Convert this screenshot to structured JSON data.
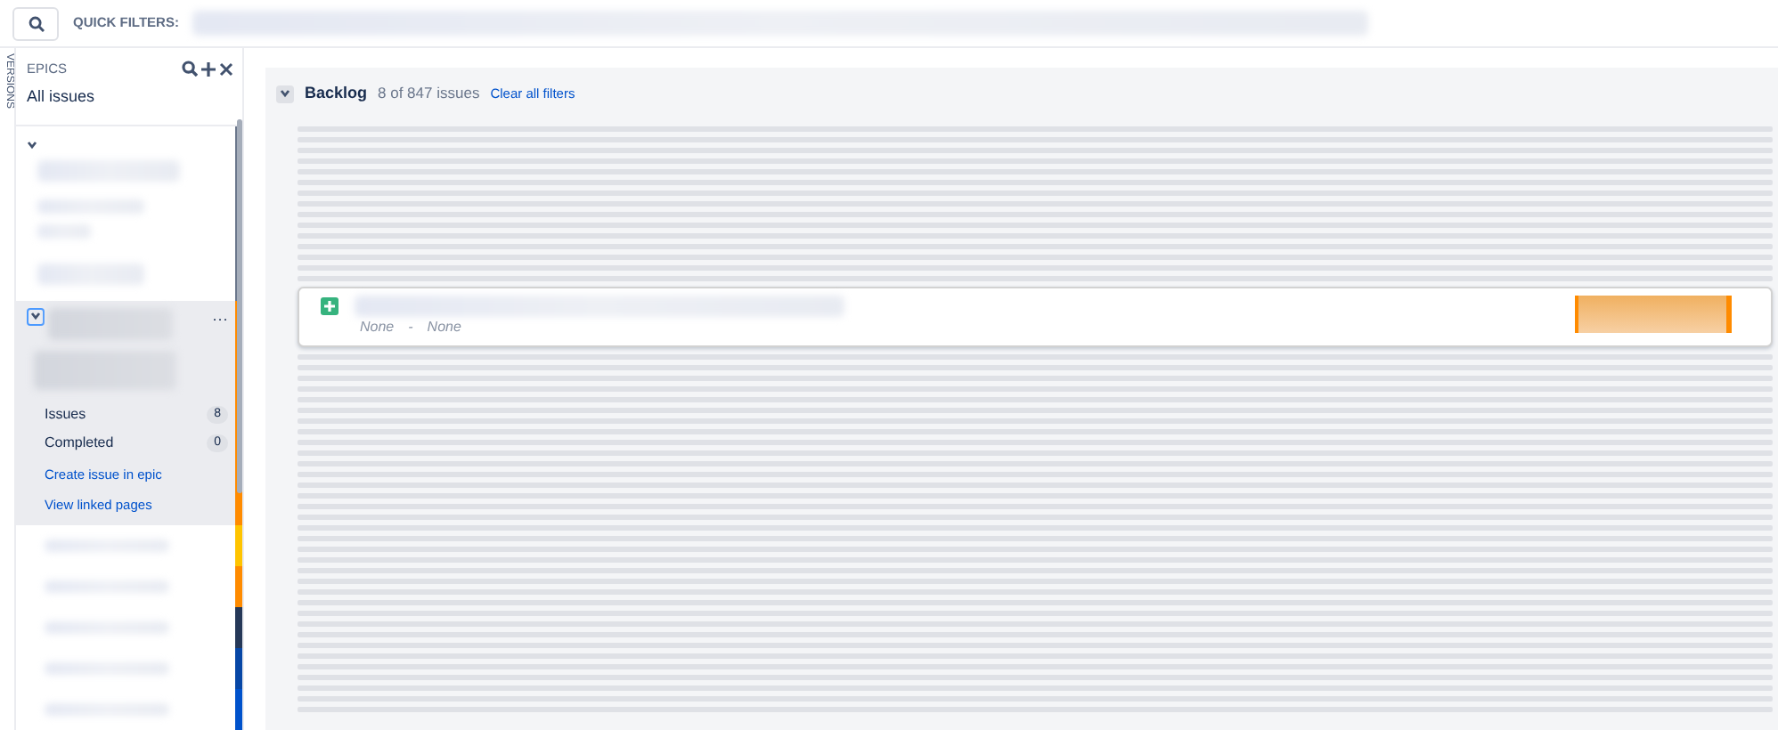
{
  "toolbar": {
    "quick_filters_label": "QUICK FILTERS:"
  },
  "side_tab": {
    "label": "VERSIONS"
  },
  "epics_panel": {
    "title": "EPICS",
    "all_issues": "All issues",
    "epics": [
      {
        "color": "#6b778c",
        "expanded": true,
        "selected": false
      },
      {
        "color": "#ff8b00",
        "expanded": true,
        "selected": true,
        "menu": "···",
        "stats": [
          {
            "label": "Issues",
            "count": "8"
          },
          {
            "label": "Completed",
            "count": "0"
          }
        ],
        "links": [
          "Create issue in epic",
          "View linked pages"
        ]
      },
      {
        "color": "#ffc400",
        "expanded": false,
        "selected": false
      },
      {
        "color": "#ff8b00",
        "expanded": false,
        "selected": false
      },
      {
        "color": "#253858",
        "expanded": false,
        "selected": false
      },
      {
        "color": "#0747a6",
        "expanded": false,
        "selected": false
      },
      {
        "color": "#0052cc",
        "expanded": false,
        "selected": false
      }
    ]
  },
  "backlog": {
    "title": "Backlog",
    "count": "8 of 847 issues",
    "clear_link": "Clear all filters",
    "issue": {
      "meta": [
        "None",
        "None"
      ],
      "separator": "-"
    }
  }
}
